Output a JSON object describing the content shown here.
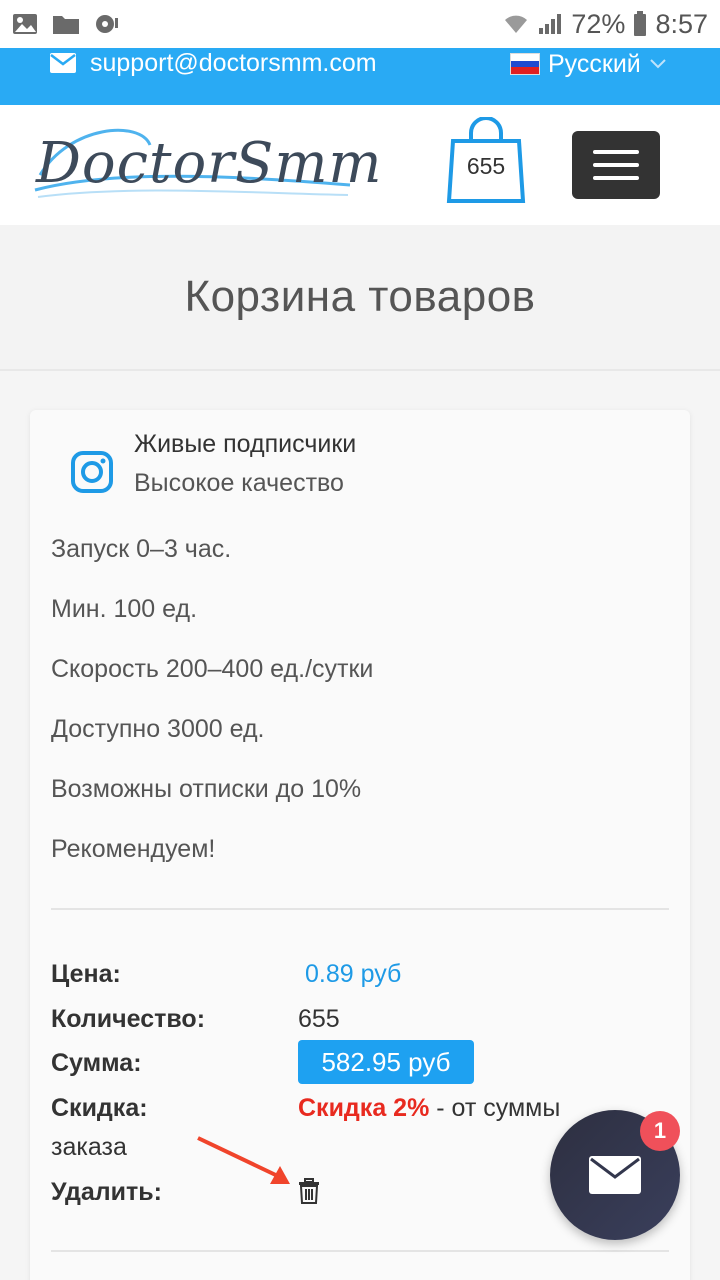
{
  "status_bar": {
    "battery": "72%",
    "time": "8:57"
  },
  "topbar": {
    "email": "support@doctorsmm.com",
    "language": "Русский"
  },
  "header": {
    "logo_text": "DoctorSmm",
    "cart_count": "655"
  },
  "page": {
    "title": "Корзина товаров"
  },
  "product": {
    "title": "Живые подписчики",
    "subtitle": "Высокое качество",
    "features": [
      "Запуск 0–3 час.",
      "Мин. 100 ед.",
      "Скорость 200–400 ед./сутки",
      "Доступно 3000 ед.",
      "Возможны отписки до 10%",
      "Рекомендуем!"
    ]
  },
  "details": {
    "price_label": "Цена:",
    "price_value": "0.89 руб",
    "quantity_label": "Количество:",
    "quantity_value": "655",
    "sum_label": "Сумма:",
    "sum_value": "582.95 руб",
    "discount_label": "Скидка:",
    "discount_highlight": "Скидка 2%",
    "discount_rest": " - от суммы",
    "discount_cont": "заказа",
    "delete_label": "Удалить:"
  },
  "fab": {
    "badge": "1",
    "icon": "envelope-icon"
  },
  "colors": {
    "accent": "#29aaf4",
    "price": "#1e9ae6",
    "discount": "#e82a1f",
    "badge": "#f0505a"
  }
}
